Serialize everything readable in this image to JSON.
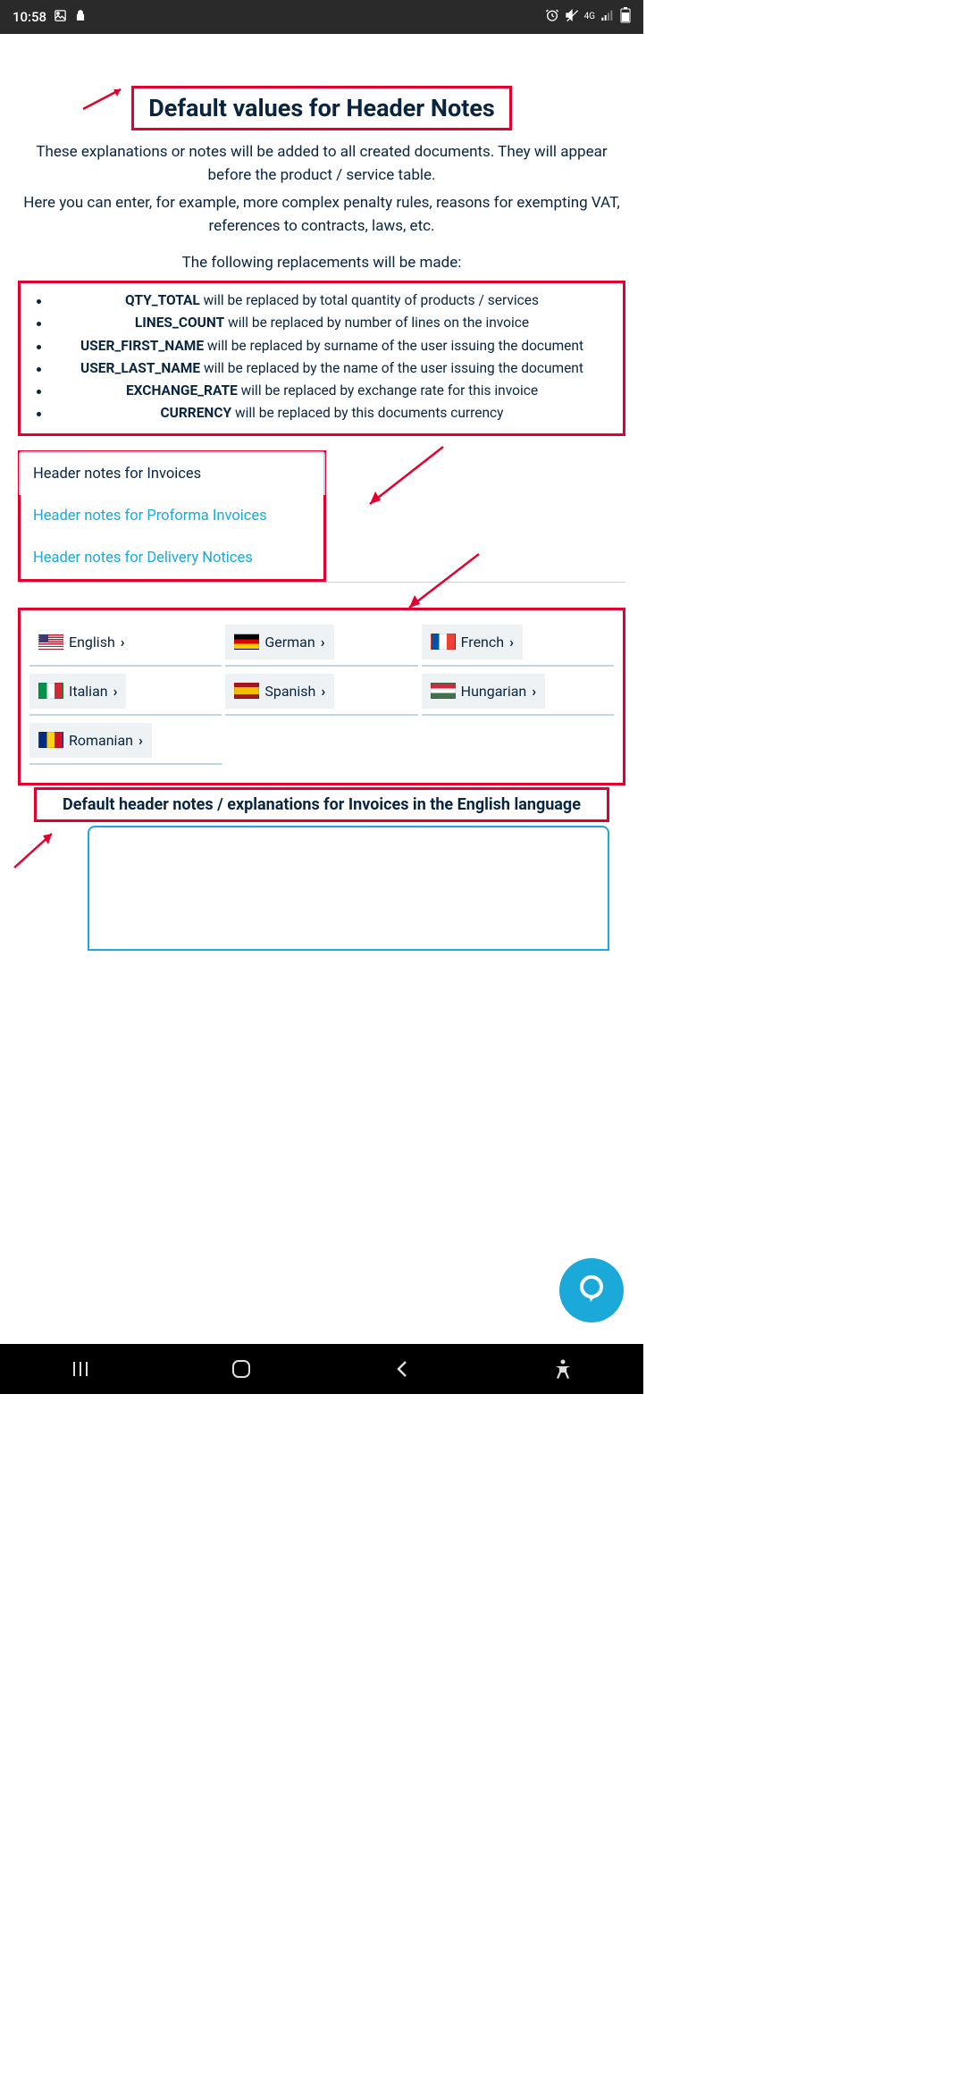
{
  "status": {
    "time": "10:58",
    "network": "4G"
  },
  "page": {
    "title": "Default values for Header Notes",
    "desc1": "These explanations or notes will be added to all created documents. They will appear before the product / service table.",
    "desc2": "Here you can enter, for example, more complex penalty rules, reasons for exempting VAT, references to contracts, laws, etc.",
    "replacements_intro": "The following replacements will be made:"
  },
  "replacements": [
    {
      "key": "QTY_TOTAL",
      "text": " will be replaced by total quantity of products / services"
    },
    {
      "key": "LINES_COUNT",
      "text": " will be replaced by number of lines on the invoice"
    },
    {
      "key": "USER_FIRST_NAME",
      "text": " will be replaced by surname of the user issuing the document"
    },
    {
      "key": "USER_LAST_NAME",
      "text": " will be replaced by the name of the user issuing the document"
    },
    {
      "key": "EXCHANGE_RATE",
      "text": " will be replaced by exchange rate for this invoice"
    },
    {
      "key": "CURRENCY",
      "text": " will be replaced by this documents currency"
    }
  ],
  "tabs": {
    "invoices": "Header notes for Invoices",
    "proforma": "Header notes for Proforma Invoices",
    "delivery": "Header notes for Delivery Notices"
  },
  "languages": {
    "english": "English",
    "german": "German",
    "french": "French",
    "italian": "Italian",
    "spanish": "Spanish",
    "hungarian": "Hungarian",
    "romanian": "Romanian"
  },
  "subheading": "Default header notes / explanations for Invoices in the English language"
}
